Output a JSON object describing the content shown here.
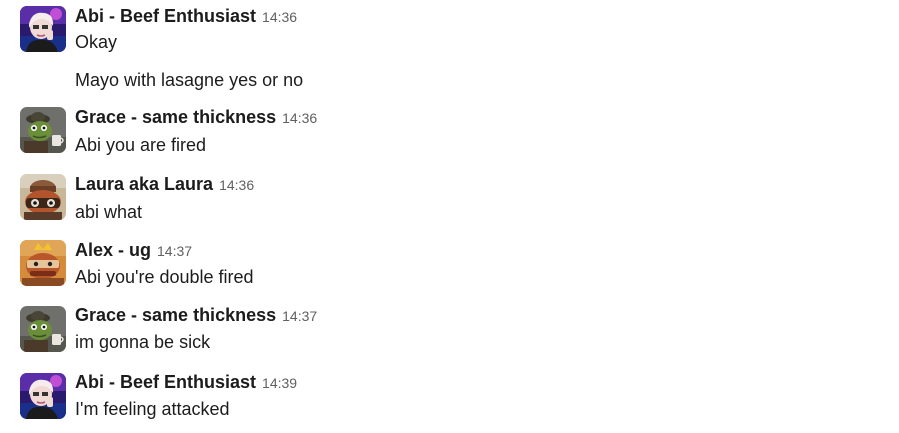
{
  "messages": [
    {
      "sender": "Abi - Beef Enthusiast",
      "time": "14:36",
      "lines": [
        "Okay",
        "Mayo with lasagne yes or no"
      ],
      "avatar": "abi"
    },
    {
      "sender": "Grace - same thickness",
      "time": "14:36",
      "lines": [
        "Abi you are fired"
      ],
      "avatar": "grace"
    },
    {
      "sender": "Laura aka Laura",
      "time": "14:36",
      "lines": [
        "abi what"
      ],
      "avatar": "laura"
    },
    {
      "sender": "Alex - ug",
      "time": "14:37",
      "lines": [
        "Abi you're double fired"
      ],
      "avatar": "alex"
    },
    {
      "sender": "Grace - same thickness",
      "time": "14:37",
      "lines": [
        "im gonna be sick"
      ],
      "avatar": "grace"
    },
    {
      "sender": "Abi - Beef Enthusiast",
      "time": "14:39",
      "lines": [
        "I'm feeling attacked"
      ],
      "avatar": "abi"
    }
  ],
  "colors": {
    "name": "#1d1c1d",
    "timestamp": "#616061",
    "text": "#1d1c1d",
    "background": "#ffffff"
  }
}
